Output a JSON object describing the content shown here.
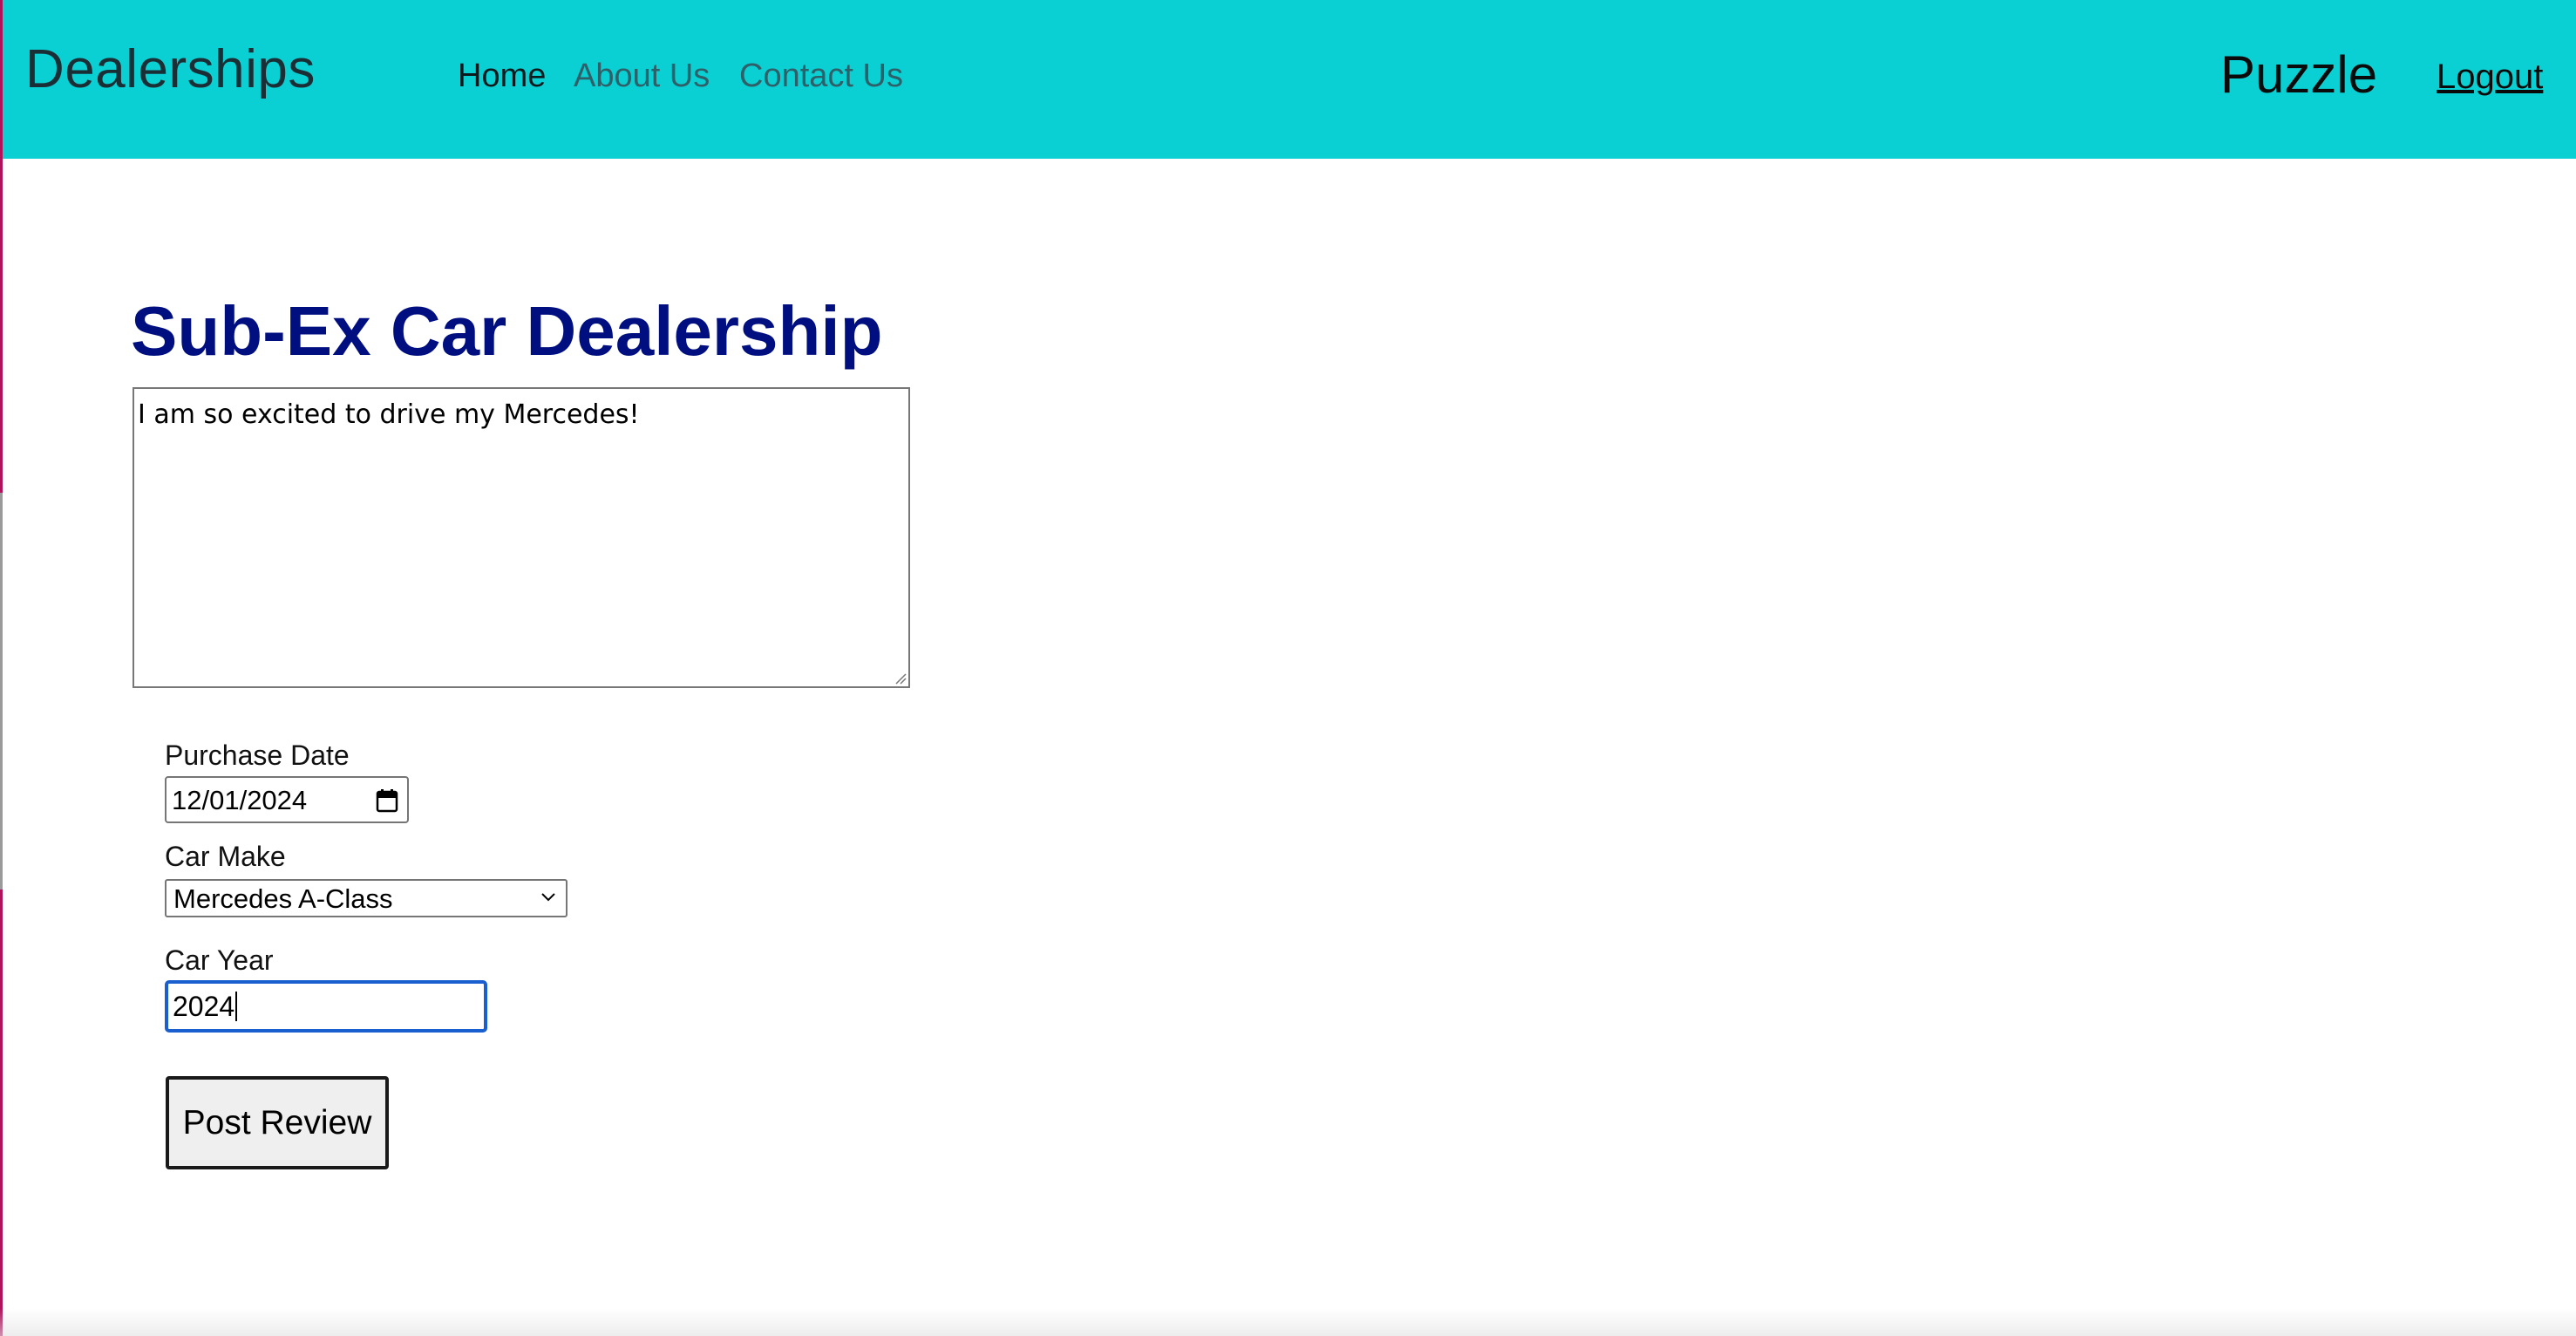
{
  "navbar": {
    "brand": "Dealerships",
    "links": [
      {
        "label": "Home",
        "active": true
      },
      {
        "label": "About Us",
        "active": false
      },
      {
        "label": "Contact Us",
        "active": false
      }
    ],
    "username": "Puzzle",
    "logout_label": "Logout",
    "background_color": "#0ad0d3"
  },
  "main": {
    "title": "Sub-Ex Car Dealership",
    "title_color": "#000f80",
    "review_text": "I am so excited to drive my Mercedes!",
    "form": {
      "purchase_date": {
        "label": "Purchase Date",
        "value": "12/01/2024",
        "icon": "calendar-icon"
      },
      "car_make": {
        "label": "Car Make",
        "selected": "Mercedes A-Class",
        "icon": "chevron-down-icon"
      },
      "car_year": {
        "label": "Car Year",
        "value": "2024",
        "focused": true
      },
      "submit_label": "Post Review"
    }
  }
}
